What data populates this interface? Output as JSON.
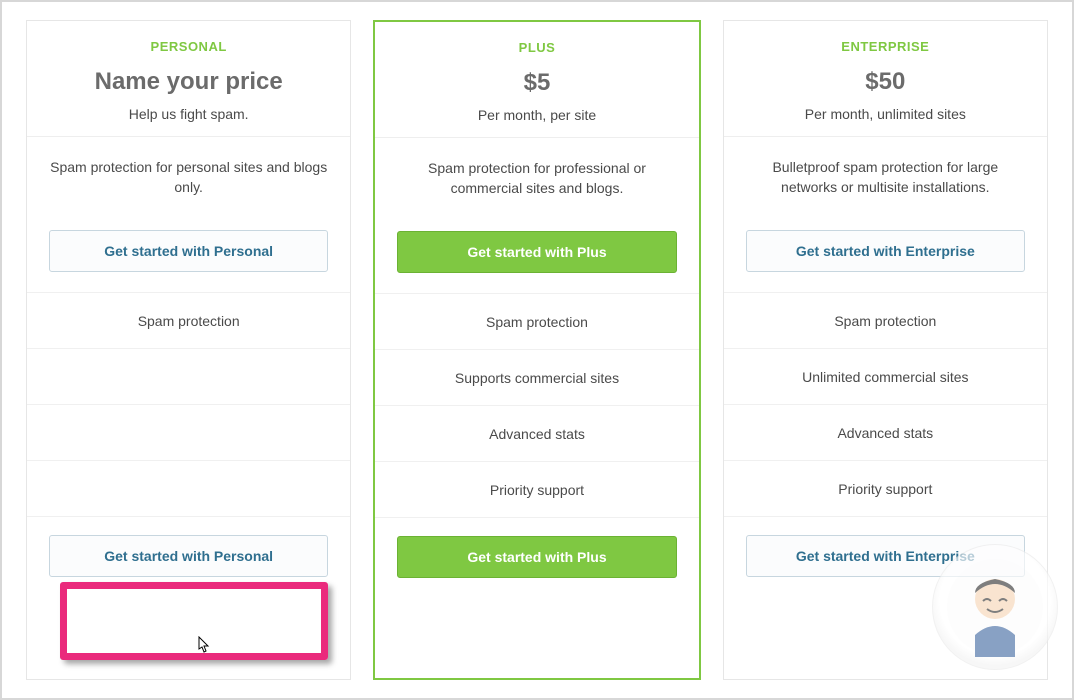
{
  "plans": [
    {
      "name": "PERSONAL",
      "price": "Name your price",
      "sub": "Help us fight spam.",
      "desc": "Spam protection for personal sites and blogs only.",
      "cta": "Get started with Personal",
      "features": [
        "Spam protection",
        "",
        "",
        ""
      ],
      "cta2": "Get started with Personal",
      "style": "outline"
    },
    {
      "name": "PLUS",
      "price": "$5",
      "sub": "Per month, per site",
      "desc": "Spam protection for professional or commercial sites and blogs.",
      "cta": "Get started with Plus",
      "features": [
        "Spam protection",
        "Supports commercial sites",
        "Advanced stats",
        "Priority support"
      ],
      "cta2": "Get started with Plus",
      "style": "solid"
    },
    {
      "name": "ENTERPRISE",
      "price": "$50",
      "sub": "Per month, unlimited sites",
      "desc": "Bulletproof spam protection for large networks or multisite installations.",
      "cta": "Get started with Enterprise",
      "features": [
        "Spam protection",
        "Unlimited commercial sites",
        "Advanced stats",
        "Priority support"
      ],
      "cta2": "Get started with Enterprise",
      "style": "outline"
    }
  ]
}
